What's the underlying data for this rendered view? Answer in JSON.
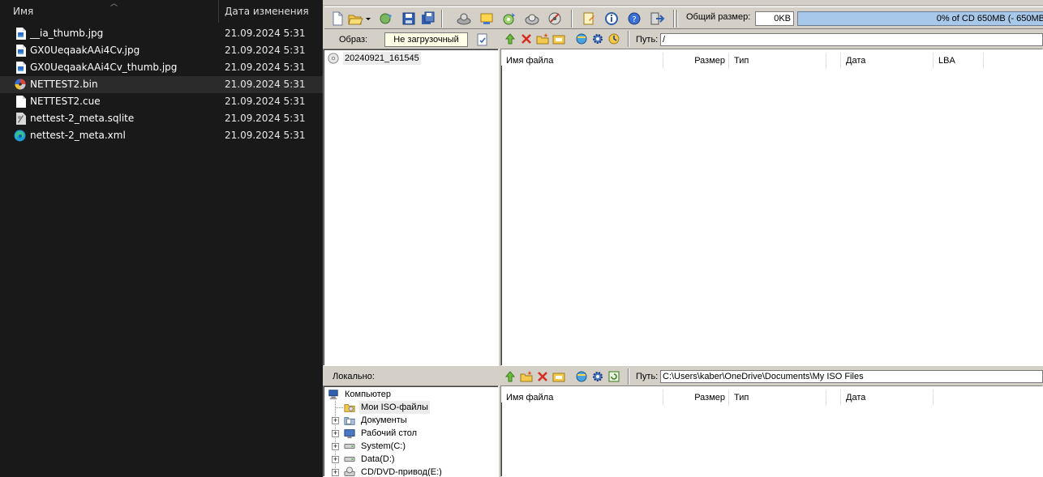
{
  "explorer": {
    "col_name": "Имя",
    "col_date": "Дата изменения",
    "files": [
      {
        "name": "__ia_thumb.jpg",
        "date": "21.09.2024 5:31",
        "icon": "image-file-icon"
      },
      {
        "name": "GX0UeqaakAAi4Cv.jpg",
        "date": "21.09.2024 5:31",
        "icon": "image-file-icon"
      },
      {
        "name": "GX0UeqaakAAi4Cv_thumb.jpg",
        "date": "21.09.2024 5:31",
        "icon": "image-file-icon"
      },
      {
        "name": "NETTEST2.bin",
        "date": "21.09.2024 5:31",
        "icon": "disc-image-icon"
      },
      {
        "name": "NETTEST2.cue",
        "date": "21.09.2024 5:31",
        "icon": "blank-file-icon"
      },
      {
        "name": "nettest-2_meta.sqlite",
        "date": "21.09.2024 5:31",
        "icon": "sqlite-file-icon"
      },
      {
        "name": "nettest-2_meta.xml",
        "date": "21.09.2024 5:31",
        "icon": "edge-xml-icon"
      }
    ]
  },
  "app": {
    "toolbar": {
      "total_size_label": "Общий размер:",
      "total_size_value": "0KB",
      "cd_capacity_text": "0% of CD 650MB (- 650MB",
      "cd_fill_percent": 0
    },
    "image_panel": {
      "label": "Образ:",
      "boot_status": "Не загрузочный",
      "path_label": "Путь:",
      "path_value": "/",
      "root_item": "20240921_161545",
      "columns": [
        "Имя файла",
        "Размер",
        "Тип",
        "Дата",
        "LBA"
      ]
    },
    "local_panel": {
      "label": "Локально:",
      "path_label": "Путь:",
      "path_value": "C:\\Users\\kaber\\OneDrive\\Documents\\My ISO Files",
      "columns": [
        "Имя файла",
        "Размер",
        "Тип",
        "Дата"
      ],
      "tree": [
        {
          "label": "Компьютер",
          "icon": "computer-icon"
        },
        {
          "label": "Мои ISO-файлы",
          "icon": "iso-folder-icon"
        },
        {
          "label": "Документы",
          "icon": "documents-folder-icon"
        },
        {
          "label": "Рабочий стол",
          "icon": "desktop-icon"
        },
        {
          "label": "System(C:)",
          "icon": "hard-drive-icon"
        },
        {
          "label": "Data(D:)",
          "icon": "hard-drive-icon"
        },
        {
          "label": "CD/DVD-привод(E:)",
          "icon": "cd-drive-icon"
        }
      ]
    }
  }
}
